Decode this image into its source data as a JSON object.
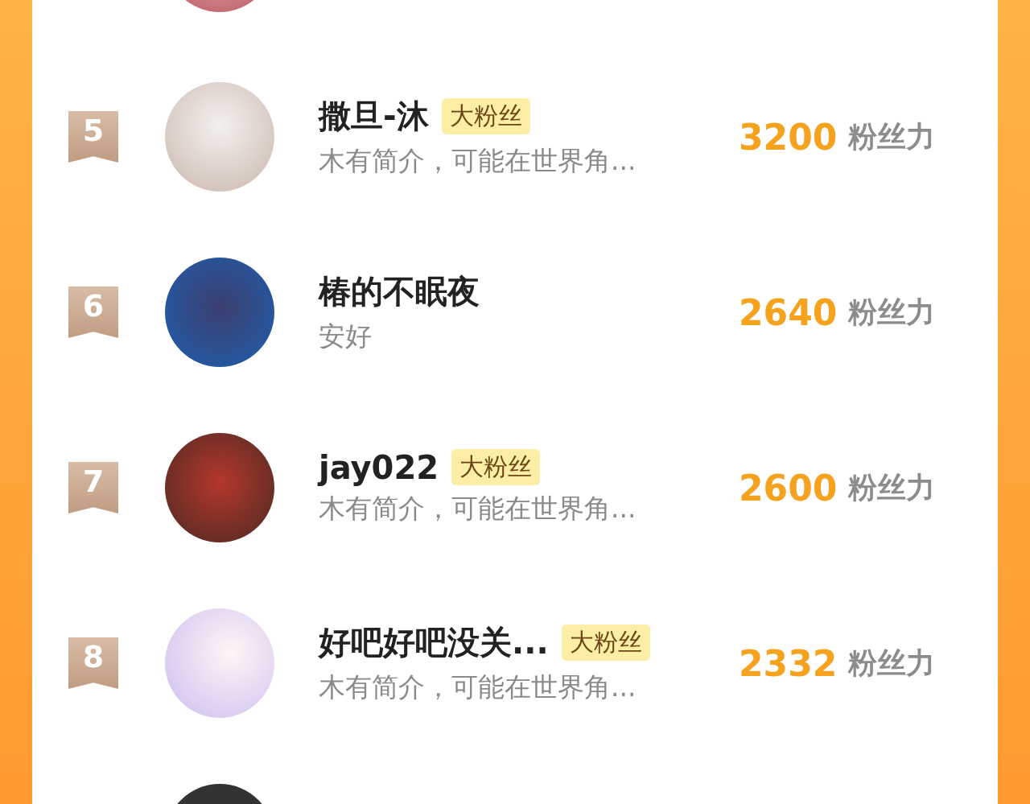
{
  "ranking": [
    {
      "rank": "5",
      "name": "撒旦-沐",
      "badge": "大粉丝",
      "bio": "木有简介，可能在世界角...",
      "score": "3200",
      "score_unit": "粉丝力"
    },
    {
      "rank": "6",
      "name": "椿的不眠夜",
      "bio": "安好",
      "score": "2640",
      "score_unit": "粉丝力"
    },
    {
      "rank": "7",
      "name": "jay022",
      "badge": "大粉丝",
      "bio": "木有简介，可能在世界角...",
      "score": "2600",
      "score_unit": "粉丝力"
    },
    {
      "rank": "8",
      "name": "好吧好吧没关...",
      "badge": "大粉丝",
      "bio": "木有简介，可能在世界角...",
      "score": "2332",
      "score_unit": "粉丝力"
    }
  ]
}
